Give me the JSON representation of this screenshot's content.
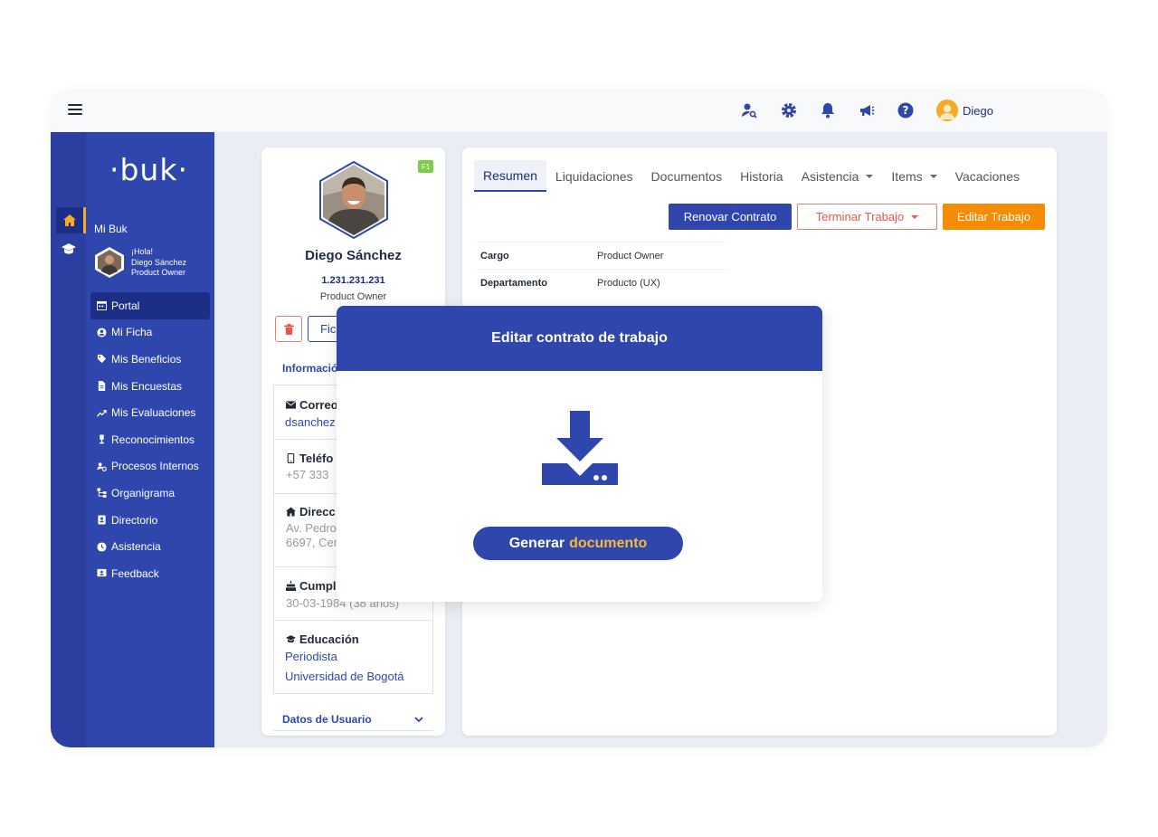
{
  "topbar": {
    "user_name": "Diego"
  },
  "sidebar": {
    "logo": "·buk·",
    "section_title": "Mi Buk",
    "greeting": [
      "¡Hola!",
      "Diego Sánchez",
      "Product Owner"
    ],
    "items": [
      {
        "label": "Portal",
        "icon": "calendar-icon"
      },
      {
        "label": "Mi Ficha",
        "icon": "user-circle-icon"
      },
      {
        "label": "Mis Beneficios",
        "icon": "tag-icon"
      },
      {
        "label": "Mis Encuestas",
        "icon": "document-icon"
      },
      {
        "label": "Mis Evaluaciones",
        "icon": "trend-icon"
      },
      {
        "label": "Reconocimientos",
        "icon": "trophy-icon"
      },
      {
        "label": "Procesos Internos",
        "icon": "people-gear-icon"
      },
      {
        "label": "Organigrama",
        "icon": "org-chart-icon"
      },
      {
        "label": "Directorio",
        "icon": "contact-book-icon"
      },
      {
        "label": "Asistencia",
        "icon": "clock-icon"
      },
      {
        "label": "Feedback",
        "icon": "feedback-icon"
      }
    ]
  },
  "profile": {
    "badge": "F1",
    "name": "Diego Sánchez",
    "rut": "1.231.231.231",
    "role": "Product Owner",
    "ficha_label": "Fic",
    "info_title": "Informació",
    "sections": {
      "correo": {
        "label": "Correo",
        "value": "dsanchez"
      },
      "telefono": {
        "label": "Teléfo",
        "value": "+57 333"
      },
      "direccion": {
        "label": "Direcc",
        "line1": "Av. Pedro",
        "line2": "6697, Cer"
      },
      "cumple": {
        "label": "Cumpl",
        "value": "30-03-1984 (38 años)"
      },
      "educacion": {
        "label": "Educación",
        "line1": "Periodista",
        "line2": "Universidad de Bogotá"
      }
    },
    "datos_usuario": "Datos de Usuario"
  },
  "main": {
    "tabs": [
      {
        "label": "Resumen",
        "dropdown": false
      },
      {
        "label": "Liquidaciones",
        "dropdown": false
      },
      {
        "label": "Documentos",
        "dropdown": false
      },
      {
        "label": "Historia",
        "dropdown": false
      },
      {
        "label": "Asistencia",
        "dropdown": true
      },
      {
        "label": "Items",
        "dropdown": true
      },
      {
        "label": "Vacaciones",
        "dropdown": false
      }
    ],
    "actions": {
      "renovar": "Renovar Contrato",
      "terminar": "Terminar Trabajo",
      "editar": "Editar Trabajo"
    },
    "details": [
      {
        "key": "Cargo",
        "value": "Product Owner"
      },
      {
        "key": "Departamento",
        "value": "Producto (UX)"
      }
    ]
  },
  "modal": {
    "title": "Editar contrato de trabajo",
    "button_main": "Generar",
    "button_highlight": "documento"
  },
  "colors": {
    "primary": "#2f47ad",
    "sidebar_dark": "#1c2e85",
    "accent_orange": "#f58c04",
    "danger": "#e8574a",
    "highlight_yellow": "#f7b93a"
  }
}
